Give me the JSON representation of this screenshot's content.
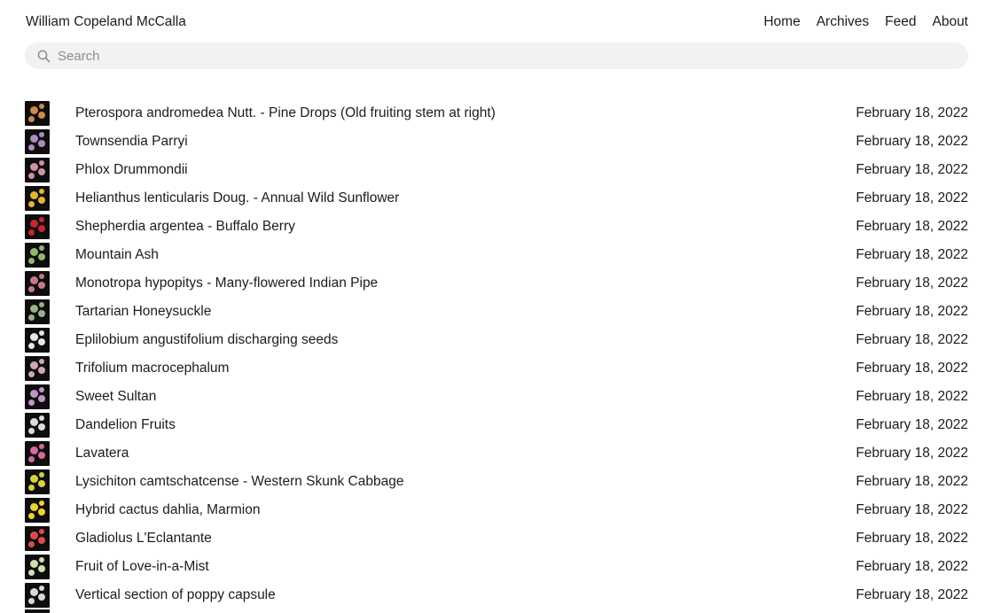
{
  "header": {
    "site_title": "William Copeland McCalla",
    "nav": [
      {
        "label": "Home"
      },
      {
        "label": "Archives"
      },
      {
        "label": "Feed"
      },
      {
        "label": "About"
      }
    ]
  },
  "search": {
    "placeholder": "Search",
    "icon": "search-icon"
  },
  "posts": [
    {
      "title": "Pterospora andromedea Nutt. - Pine Drops (Old fruiting stem at right)",
      "date": "February 18, 2022",
      "thumb_color": "#c98a4a"
    },
    {
      "title": "Townsendia Parryi",
      "date": "February 18, 2022",
      "thumb_color": "#b08ac0"
    },
    {
      "title": "Phlox Drummondii",
      "date": "February 18, 2022",
      "thumb_color": "#d48fa8"
    },
    {
      "title": "Helianthus lenticularis Doug. - Annual Wild Sunflower",
      "date": "February 18, 2022",
      "thumb_color": "#e3b531"
    },
    {
      "title": "Shepherdia argentea - Buffalo Berry",
      "date": "February 18, 2022",
      "thumb_color": "#c8262a"
    },
    {
      "title": "Mountain Ash",
      "date": "February 18, 2022",
      "thumb_color": "#8fb86a"
    },
    {
      "title": "Monotropa hypopitys - Many-flowered Indian Pipe",
      "date": "February 18, 2022",
      "thumb_color": "#c77a86"
    },
    {
      "title": "Tartarian Honeysuckle",
      "date": "February 18, 2022",
      "thumb_color": "#9ab08a"
    },
    {
      "title": "Eplilobium angustifolium discharging seeds",
      "date": "February 18, 2022",
      "thumb_color": "#e6e6e6"
    },
    {
      "title": "Trifolium macrocephalum",
      "date": "February 18, 2022",
      "thumb_color": "#d2a7b4"
    },
    {
      "title": "Sweet Sultan",
      "date": "February 18, 2022",
      "thumb_color": "#c493c9"
    },
    {
      "title": "Dandelion Fruits",
      "date": "February 18, 2022",
      "thumb_color": "#dcdcdc"
    },
    {
      "title": "Lavatera",
      "date": "February 18, 2022",
      "thumb_color": "#d46aa0"
    },
    {
      "title": "Lysichiton camtschatcense - Western Skunk Cabbage",
      "date": "February 18, 2022",
      "thumb_color": "#d9d23a"
    },
    {
      "title": "Hybrid cactus dahlia, Marmion",
      "date": "February 18, 2022",
      "thumb_color": "#f1d325"
    },
    {
      "title": "Gladiolus L'Eclantante",
      "date": "February 18, 2022",
      "thumb_color": "#e24a4a"
    },
    {
      "title": "Fruit of Love-in-a-Mist",
      "date": "February 18, 2022",
      "thumb_color": "#cfe0b0"
    },
    {
      "title": "Vertical section of poppy capsule",
      "date": "February 18, 2022",
      "thumb_color": "#d8d8d8"
    }
  ]
}
